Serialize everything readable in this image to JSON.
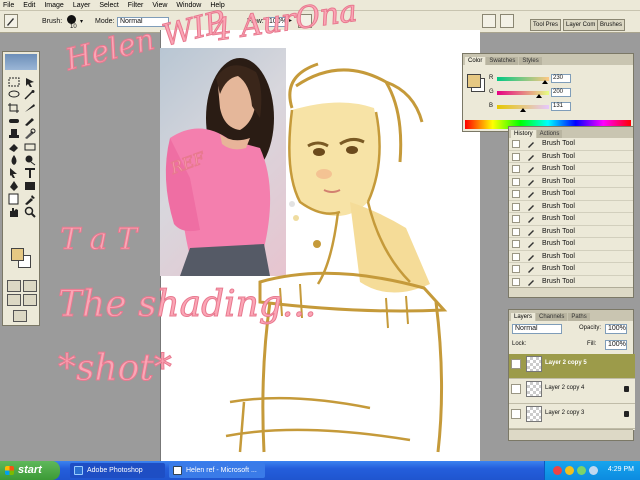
{
  "menu": [
    "File",
    "Edit",
    "Image",
    "Layer",
    "Select",
    "Filter",
    "View",
    "Window",
    "Help"
  ],
  "options": {
    "brush_label": "Brush:",
    "brush_size": "10",
    "mode_label": "Mode:",
    "mode_value": "Normal",
    "flow_label": "Flow:",
    "flow_value": "100%"
  },
  "palette_well": [
    "Tool Pres",
    "Layer Com",
    "Brushes"
  ],
  "color_panel": {
    "tabs": [
      "Color",
      "Swatches",
      "Styles"
    ],
    "channels": [
      {
        "label": "R",
        "value": "230"
      },
      {
        "label": "G",
        "value": "200"
      },
      {
        "label": "B",
        "value": "131"
      }
    ],
    "foreground": "#e6c883",
    "background": "#ffffff"
  },
  "history_panel": {
    "tabs": [
      "History",
      "Actions"
    ],
    "items": [
      "Brush Tool",
      "Brush Tool",
      "Brush Tool",
      "Brush Tool",
      "Brush Tool",
      "Brush Tool",
      "Brush Tool",
      "Brush Tool",
      "Brush Tool",
      "Brush Tool",
      "Brush Tool",
      "Brush Tool"
    ]
  },
  "layers_panel": {
    "tabs": [
      "Layers",
      "Channels",
      "Paths"
    ],
    "blend_mode": "Normal",
    "opacity_label": "Opacity:",
    "opacity_value": "100%",
    "lock_label": "Lock:",
    "fill_label": "Fill:",
    "fill_value": "100%",
    "layers": [
      {
        "name": "Layer 2 copy 5",
        "selected": true
      },
      {
        "name": "Layer 2 copy 4",
        "selected": false
      },
      {
        "name": "Layer 2 copy 3",
        "selected": false
      }
    ]
  },
  "annotations": {
    "title_line1": "Helen WIP",
    "title_line2": "4 AurOna",
    "ref": "REF",
    "face": "T a T",
    "shading": "The shading...",
    "shot": "*shot*"
  },
  "taskbar": {
    "start": "start",
    "tasks": [
      "Adobe Photoshop",
      "Helen ref - Microsoft ..."
    ],
    "clock": "4:29 PM"
  },
  "colors": {
    "sketch_line": "#c59a3a",
    "skin": "#f7e3a6",
    "annotation_pink": "#fba6b6",
    "selected_layer": "#9c9b4a"
  }
}
